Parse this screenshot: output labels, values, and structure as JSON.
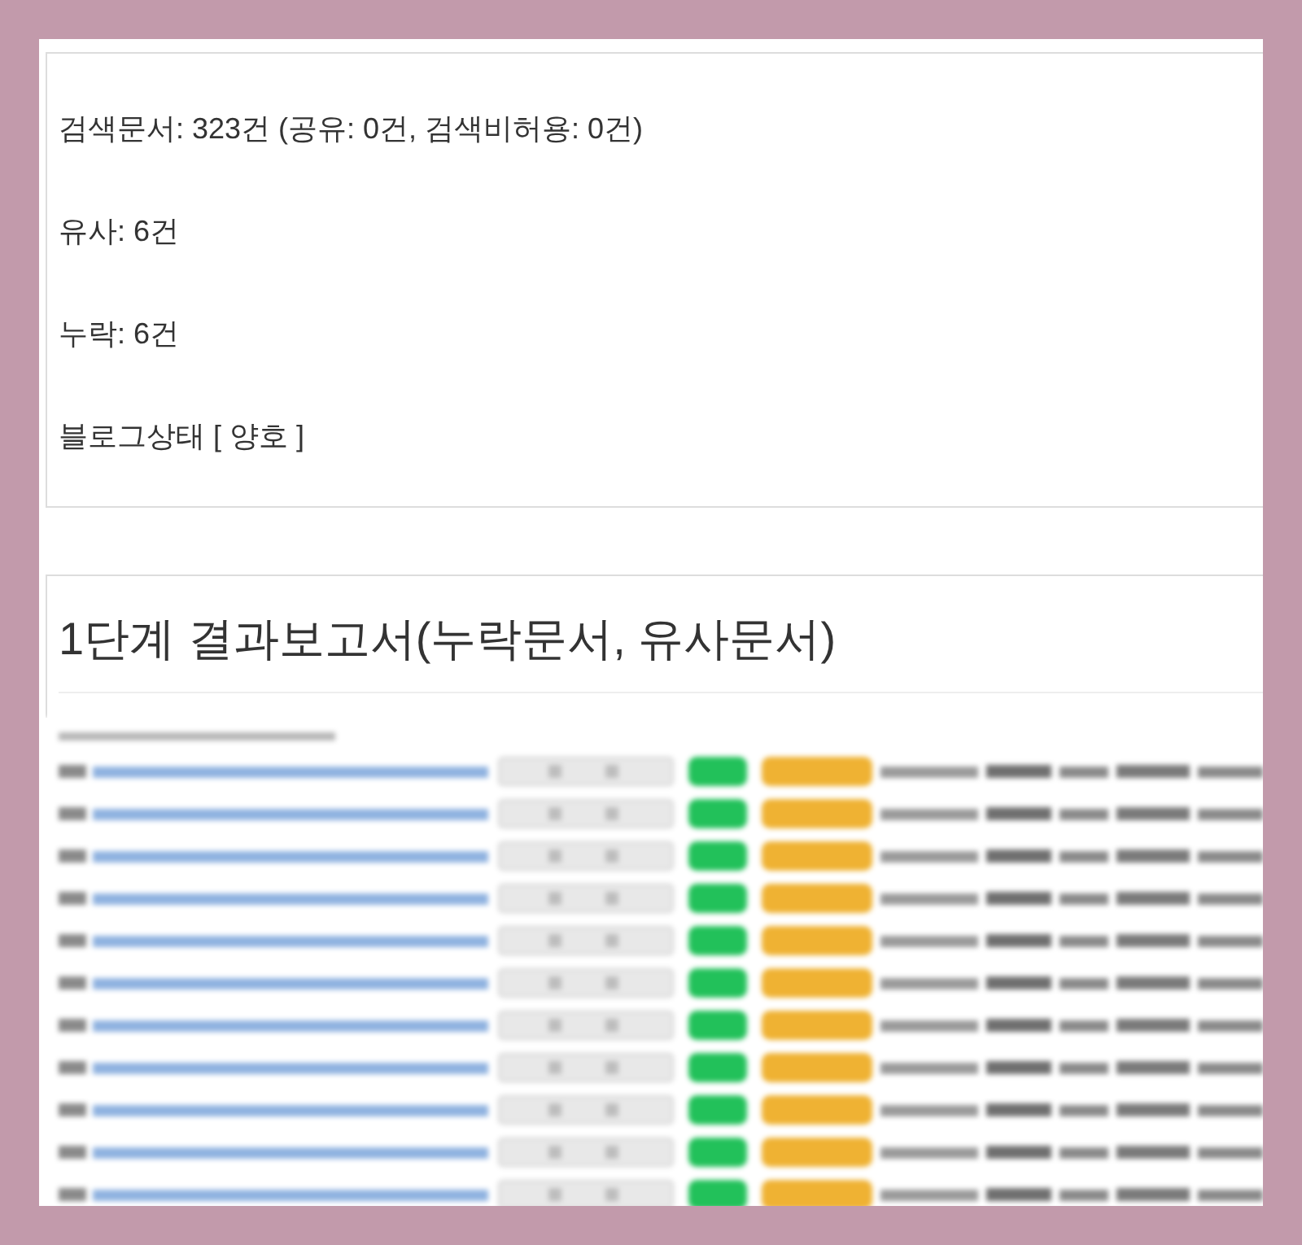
{
  "summary_card": {
    "lines": [
      "검색문서: 323건 (공유: 0건, 검색비허용: 0건)",
      "유사: 6건",
      "누락: 6건",
      "블로그상태 [ 양호 ]"
    ]
  },
  "report_card": {
    "title": "1단계 결과보고서(누락문서, 유사문서)"
  }
}
